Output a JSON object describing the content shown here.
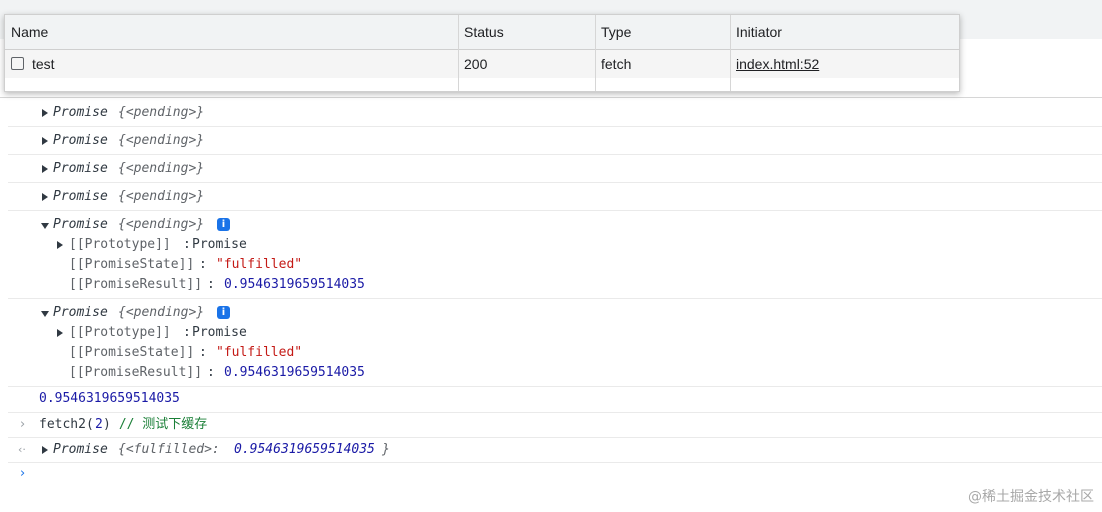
{
  "network_popup": {
    "columns": [
      "Name",
      "Status",
      "Type",
      "Initiator"
    ],
    "row": {
      "name": "test",
      "status": "200",
      "type": "fetch",
      "initiator": "index.html:52"
    }
  },
  "console": {
    "promise_label": "Promise",
    "pending_text": "{<pending>}",
    "collapsed_count": 4,
    "info_icon_glyph": "i",
    "expanded": {
      "prototype_key": "[[Prototype]]",
      "prototype_value": "Promise",
      "state_key": "[[PromiseState]]",
      "state_value": "\"fulfilled\"",
      "result_key": "[[PromiseResult]]",
      "result_value": "0.9546319659514035"
    },
    "result_line": "0.9546319659514035",
    "input": {
      "call": "fetch2(",
      "arg": "2",
      "close": ")",
      "comment": " // 测试下缓存"
    },
    "output": {
      "label": "Promise",
      "open": "{<fulfilled>: ",
      "value": "0.9546319659514035",
      "close": "}"
    },
    "prompt_glyph": "›",
    "output_glyph": "‹·",
    "input_glyph": "›"
  },
  "watermark": "@稀土掘金技术社区"
}
